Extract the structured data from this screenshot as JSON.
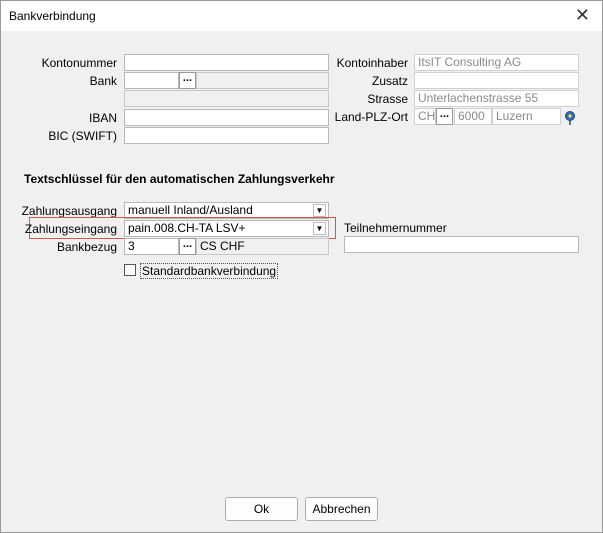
{
  "window": {
    "title": "Bankverbindung"
  },
  "left": {
    "kontonummer_label": "Kontonummer",
    "bank_label": "Bank",
    "iban_label": "IBAN",
    "bic_label": "BIC (SWIFT)",
    "kontonummer_value": "",
    "bank_value": "",
    "iban_value": "",
    "bic_value": ""
  },
  "right": {
    "kontoinhaber_label": "Kontoinhaber",
    "kontoinhaber_value": "ItsIT Consulting AG",
    "zusatz_label": "Zusatz",
    "zusatz_value": "",
    "strasse_label": "Strasse",
    "strasse_value": "Unterlachenstrasse 55",
    "land_label": "Land-PLZ-Ort",
    "land_value": "CH",
    "plz_value": "6000",
    "ort_value": "Luzern"
  },
  "section": {
    "title": "Textschlüssel für den automatischen Zahlungsverkehr",
    "ausgang_label": "Zahlungsausgang",
    "ausgang_value": "manuell Inland/Ausland",
    "eingang_label": "Zahlungseingang",
    "eingang_value": "pain.008.CH-TA LSV+",
    "bankbezug_label": "Bankbezug",
    "bankbezug_value": "3",
    "bankbezug_name": "CS CHF",
    "teilnehmer_label": "Teilnehmernummer",
    "teilnehmer_value": "",
    "standard_label": "Standardbankverbindung",
    "standard_checked": false
  },
  "buttons": {
    "ok": "Ok",
    "cancel": "Abbrechen"
  },
  "icons": {
    "close": "close-icon",
    "ellipsis": "ellipsis-icon",
    "dropdown": "chevron-down-icon",
    "location": "map-pin-icon"
  }
}
